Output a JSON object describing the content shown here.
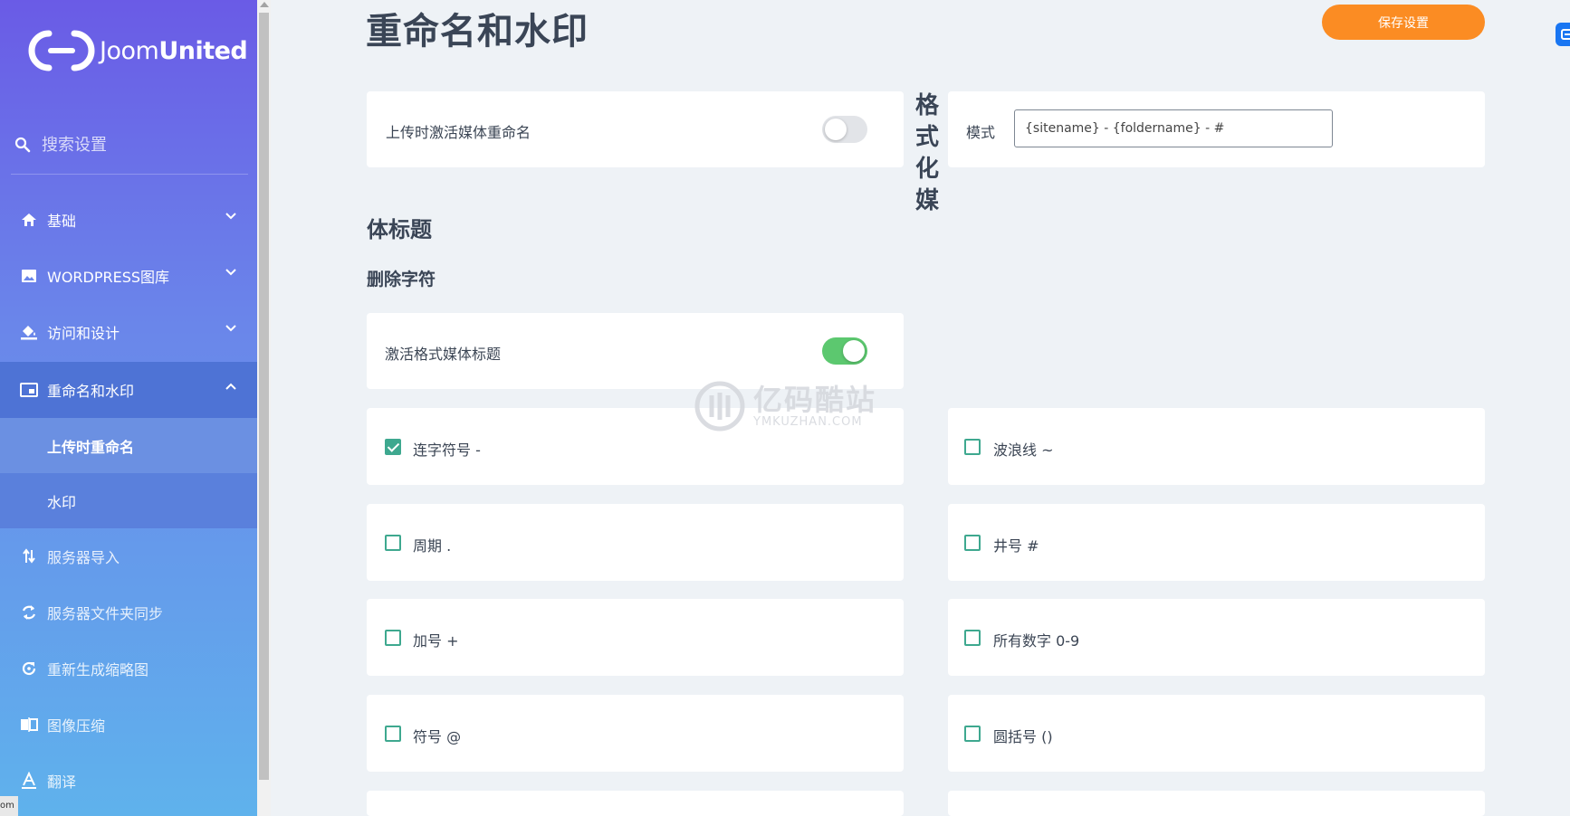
{
  "sidebar": {
    "logo": {
      "light": "Joom",
      "bold": "United"
    },
    "search_placeholder": "搜索设置",
    "items": [
      {
        "label": "基础",
        "icon": "home-icon"
      },
      {
        "label": "WORDPRESS图库",
        "icon": "image-icon"
      },
      {
        "label": "访问和设计",
        "icon": "paint-bucket-icon"
      },
      {
        "label": "重命名和水印",
        "icon": "picture-in-picture-icon"
      },
      {
        "label": "上传时重命名"
      },
      {
        "label": "水印"
      },
      {
        "label": "服务器导入",
        "icon": "import-arrows-icon"
      },
      {
        "label": "服务器文件夹同步",
        "icon": "sync-icon"
      },
      {
        "label": "重新生成缩略图",
        "icon": "refresh-icon"
      },
      {
        "label": "图像压缩",
        "icon": "compress-icon"
      },
      {
        "label": "翻译",
        "icon": "translate-icon"
      }
    ],
    "corner_text": "om"
  },
  "header": {
    "title": "重命名和水印",
    "save_label": "保存设置"
  },
  "rename": {
    "toggle_label": "上传时激活媒体重命名",
    "toggle_on": false,
    "format_heading_vertical": "格式化媒",
    "pattern_label": "模式",
    "pattern_value": "{sitename} - {foldername} - #"
  },
  "section": {
    "title_continued": "体标题",
    "remove_chars": "删除字符",
    "activate_label": "激活格式媒体标题",
    "activate_on": true
  },
  "characters": [
    {
      "label": "连字符号 -",
      "checked": true
    },
    {
      "label": "波浪线 ~",
      "checked": false
    },
    {
      "label": "周期 .",
      "checked": false
    },
    {
      "label": "井号 #",
      "checked": false
    },
    {
      "label": "加号 +",
      "checked": false
    },
    {
      "label": "所有数字 0-9",
      "checked": false
    },
    {
      "label": "符号 @",
      "checked": false
    },
    {
      "label": "圆括号 ()",
      "checked": false
    }
  ],
  "watermark": {
    "big": "亿码酷站",
    "small": "YMKUZHAN.COM"
  },
  "colors": {
    "accent": "#fb8c23",
    "toggle_on": "#5cc86f",
    "checkbox": "#3ea88f",
    "sidebar_active": "#4e73d5"
  }
}
